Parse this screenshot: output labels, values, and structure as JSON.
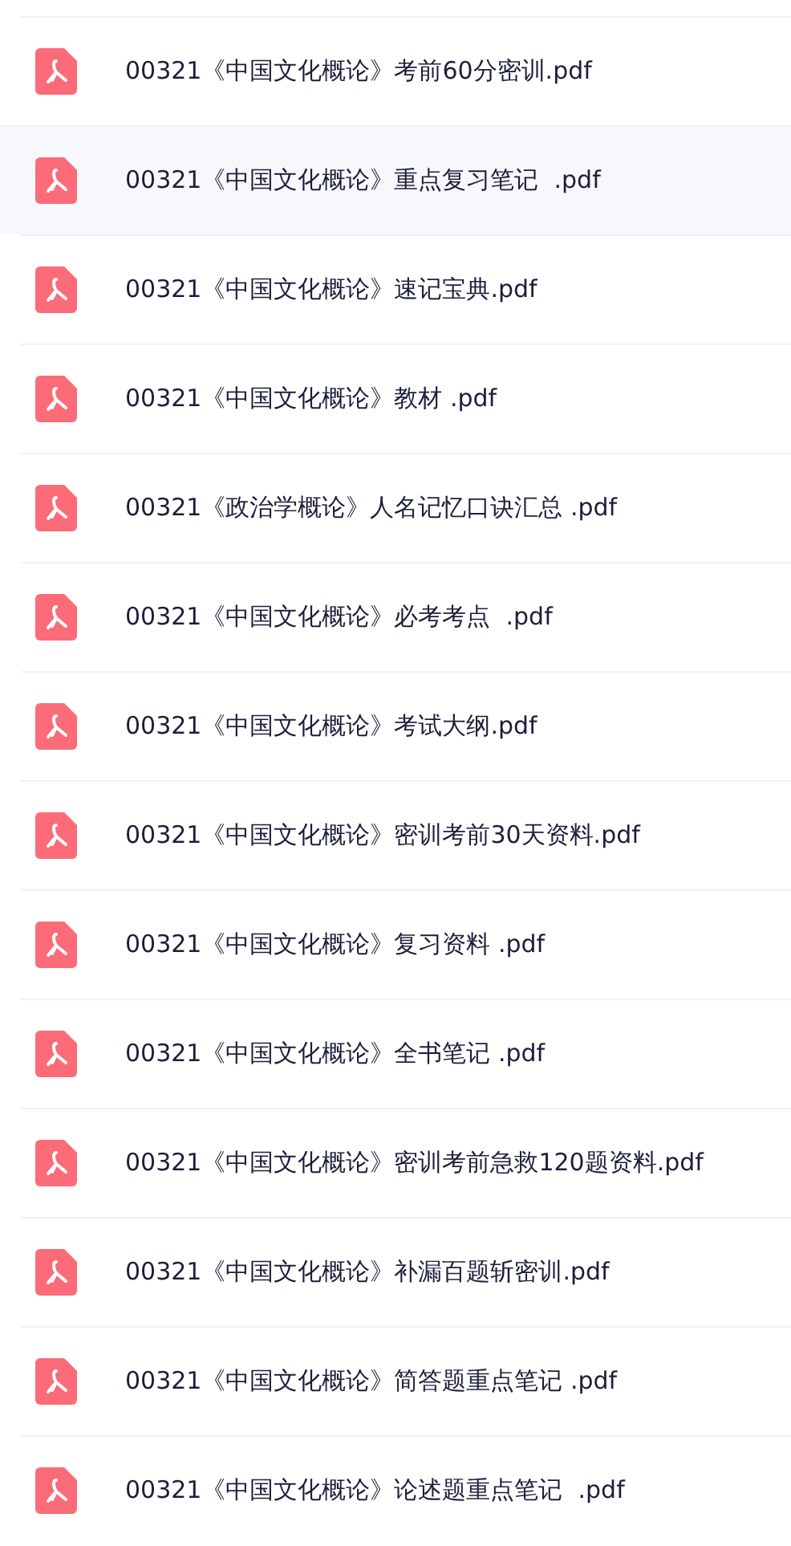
{
  "files": [
    {
      "name": "00321《中国文化概论》考前60分密训.pdf",
      "selected": false
    },
    {
      "name": "00321《中国文化概论》重点复习笔记  .pdf",
      "selected": true
    },
    {
      "name": "00321《中国文化概论》速记宝典.pdf",
      "selected": false
    },
    {
      "name": "00321《中国文化概论》教材 .pdf",
      "selected": false
    },
    {
      "name": "00321《政治学概论》人名记忆口诀汇总 .pdf",
      "selected": false
    },
    {
      "name": "00321《中国文化概论》必考考点  .pdf",
      "selected": false
    },
    {
      "name": "00321《中国文化概论》考试大纲.pdf",
      "selected": false
    },
    {
      "name": "00321《中国文化概论》密训考前30天资料.pdf",
      "selected": false
    },
    {
      "name": "00321《中国文化概论》复习资料 .pdf",
      "selected": false
    },
    {
      "name": "00321《中国文化概论》全书笔记 .pdf",
      "selected": false
    },
    {
      "name": "00321《中国文化概论》密训考前急救120题资料.pdf",
      "selected": false
    },
    {
      "name": "00321《中国文化概论》补漏百题斩密训.pdf",
      "selected": false
    },
    {
      "name": "00321《中国文化概论》简答题重点笔记 .pdf",
      "selected": false
    },
    {
      "name": "00321《中国文化概论》论述题重点笔记  .pdf",
      "selected": false
    }
  ]
}
